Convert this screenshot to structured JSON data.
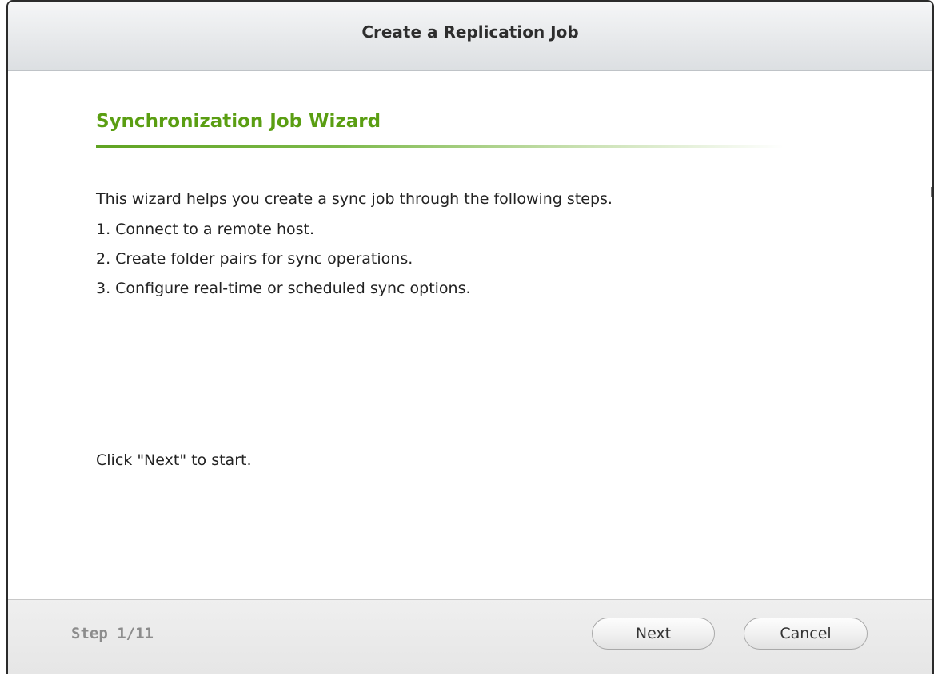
{
  "window": {
    "title": "Create a Replication Job"
  },
  "wizard": {
    "heading": "Synchronization Job Wizard",
    "intro": "This wizard helps you create a sync job through the following steps.",
    "steps": [
      "1. Connect to a remote host.",
      "2. Create folder pairs for sync operations.",
      "3. Configure real-time or scheduled sync options."
    ],
    "prompt": "Click \"Next\" to start."
  },
  "footer": {
    "step_indicator": "Step 1/11",
    "next_label": "Next",
    "cancel_label": "Cancel"
  },
  "colors": {
    "heading_green": "#5a9e12",
    "step_gray": "#8c8c8c"
  }
}
